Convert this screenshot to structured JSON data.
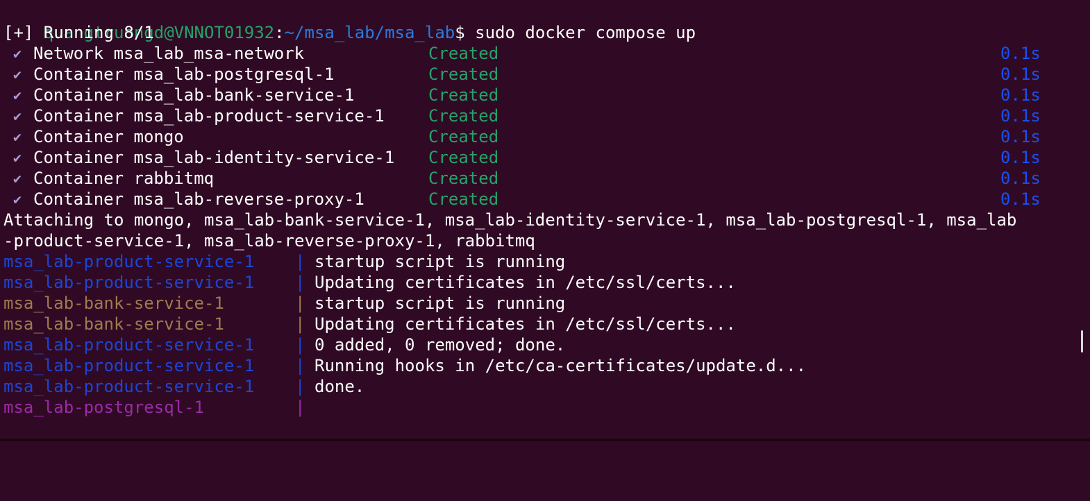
{
  "colors": {
    "background": "#300a24",
    "prompt_user": "#26a269",
    "prompt_path": "#2a7bde",
    "status_created": "#26a269",
    "timing": "#1a4ff0",
    "service_product": "#1d45d6",
    "service_bank": "#a07a4f",
    "service_postgresql": "#9b2aa8"
  },
  "prompt": {
    "user_host": "quangtruongd@VNNOT01932",
    "colon": ":",
    "path": "~/msa_lab/msa_lab",
    "symbol": "$",
    "command": " sudo docker compose up"
  },
  "running_header": "[+] Running 8/1",
  "check_icon": "✔",
  "resources": [
    {
      "name": "Network msa_lab_msa-network",
      "status": "Created",
      "time": "0.1s"
    },
    {
      "name": "Container msa_lab-postgresql-1",
      "status": "Created",
      "time": "0.1s"
    },
    {
      "name": "Container msa_lab-bank-service-1",
      "status": "Created",
      "time": "0.1s"
    },
    {
      "name": "Container msa_lab-product-service-1",
      "status": "Created",
      "time": "0.1s"
    },
    {
      "name": "Container mongo",
      "status": "Created",
      "time": "0.1s"
    },
    {
      "name": "Container msa_lab-identity-service-1",
      "status": "Created",
      "time": "0.1s"
    },
    {
      "name": "Container rabbitmq",
      "status": "Created",
      "time": "0.1s"
    },
    {
      "name": "Container msa_lab-reverse-proxy-1",
      "status": "Created",
      "time": "0.1s"
    }
  ],
  "attaching": [
    "Attaching to mongo, msa_lab-bank-service-1, msa_lab-identity-service-1, msa_lab-postgresql-1, msa_lab",
    "-product-service-1, msa_lab-reverse-proxy-1, rabbitmq"
  ],
  "separator": "|",
  "logs": [
    {
      "service": "msa_lab-product-service-1",
      "color": "blue",
      "message": "startup script is running"
    },
    {
      "service": "msa_lab-product-service-1",
      "color": "blue",
      "message": "Updating certificates in /etc/ssl/certs..."
    },
    {
      "service": "msa_lab-bank-service-1",
      "color": "brown",
      "message": "startup script is running"
    },
    {
      "service": "msa_lab-bank-service-1",
      "color": "brown",
      "message": "Updating certificates in /etc/ssl/certs..."
    },
    {
      "service": "msa_lab-product-service-1",
      "color": "blue",
      "message": "0 added, 0 removed; done."
    },
    {
      "service": "msa_lab-product-service-1",
      "color": "blue",
      "message": "Running hooks in /etc/ca-certificates/update.d..."
    },
    {
      "service": "msa_lab-product-service-1",
      "color": "blue",
      "message": "done."
    },
    {
      "service": "msa_lab-postgresql-1",
      "color": "purple",
      "message": ""
    }
  ]
}
